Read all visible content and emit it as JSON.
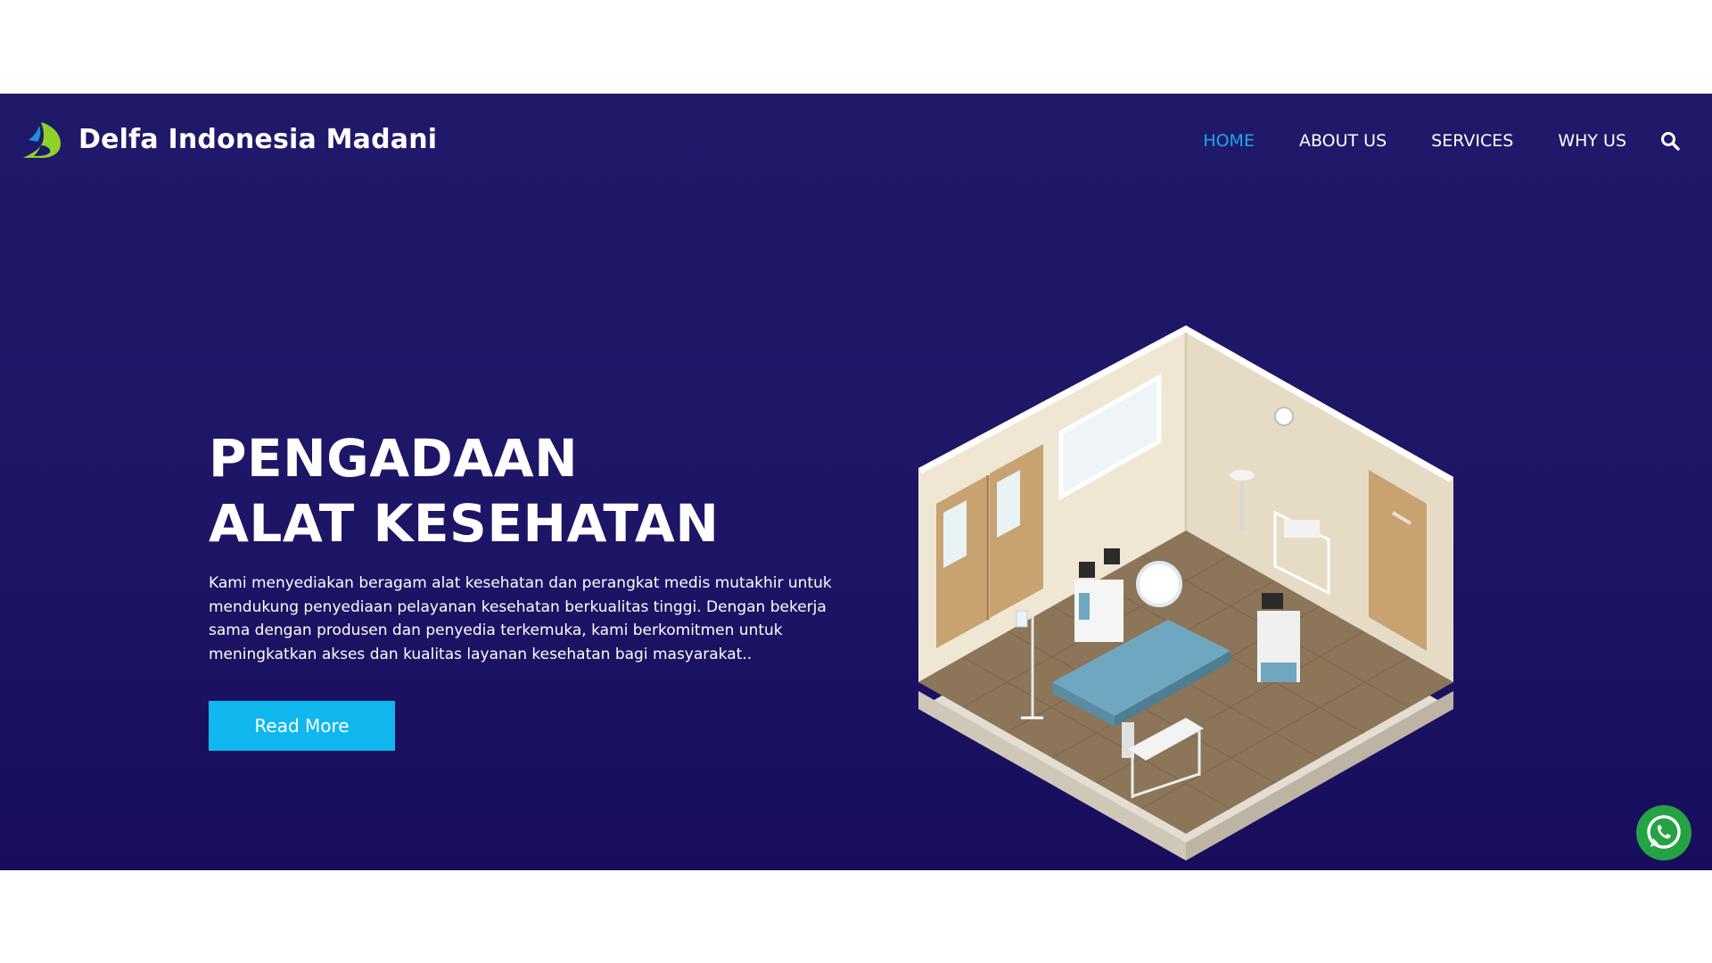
{
  "header": {
    "brand_name": "Delfa Indonesia Madani",
    "logo_icon": "delfa-logo-icon",
    "nav": [
      {
        "label": "HOME",
        "active": true
      },
      {
        "label": "ABOUT US",
        "active": false
      },
      {
        "label": "SERVICES",
        "active": false
      },
      {
        "label": "WHY US",
        "active": false
      }
    ],
    "search_icon": "search-icon"
  },
  "hero": {
    "title_line1": "PENGADAAN",
    "title_line2": "ALAT KESEHATAN",
    "description": "Kami menyediakan beragam alat kesehatan dan perangkat medis mutakhir untuk mendukung penyediaan pelayanan kesehatan berkualitas tinggi. Dengan bekerja sama dengan produsen dan penyedia terkemuka, kami berkomitmen untuk meningkatkan akses dan kualitas layanan kesehatan bagi masyarakat..",
    "button_label": "Read More",
    "illustration": "hospital-room-illustration"
  },
  "floating": {
    "whatsapp_icon": "whatsapp-icon"
  },
  "colors": {
    "hero_background": "#1d1566",
    "accent": "#10b7ef",
    "nav_active": "#18a8e8",
    "whatsapp_green": "#25a244",
    "logo_green": "#8fd12b",
    "logo_blue": "#1d8fd8"
  }
}
